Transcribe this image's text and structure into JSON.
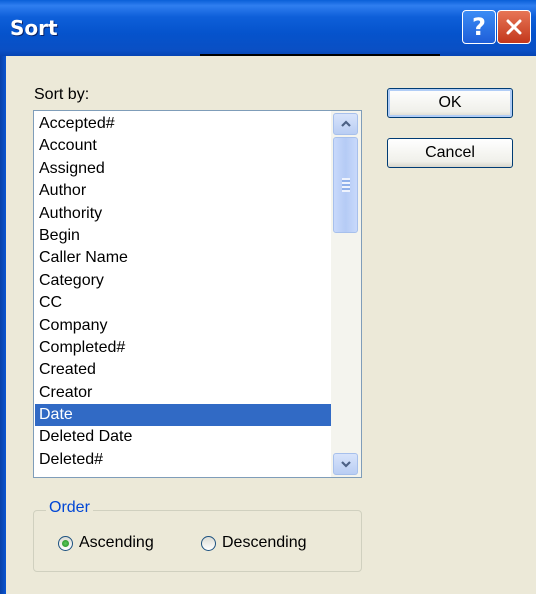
{
  "window": {
    "title": "Sort",
    "help_label": "?",
    "close_label": "✕"
  },
  "sort": {
    "label": "Sort by:",
    "items": [
      "Accepted#",
      "Account",
      "Assigned",
      "Author",
      "Authority",
      "Begin",
      "Caller Name",
      "Category",
      "CC",
      "Company",
      "Completed#",
      "Created",
      "Creator",
      "Date",
      "Deleted Date",
      "Deleted#"
    ],
    "selected": "Date"
  },
  "buttons": {
    "ok_label": "OK",
    "cancel_label": "Cancel"
  },
  "order": {
    "label": "Order",
    "ascending_label": "Ascending",
    "descending_label": "Descending",
    "selected": "Ascending"
  },
  "colors": {
    "selection": "#316ac5",
    "titlebar": "#0553cc",
    "dialog_face": "#ece9d8",
    "order_legend": "#0046d5"
  }
}
